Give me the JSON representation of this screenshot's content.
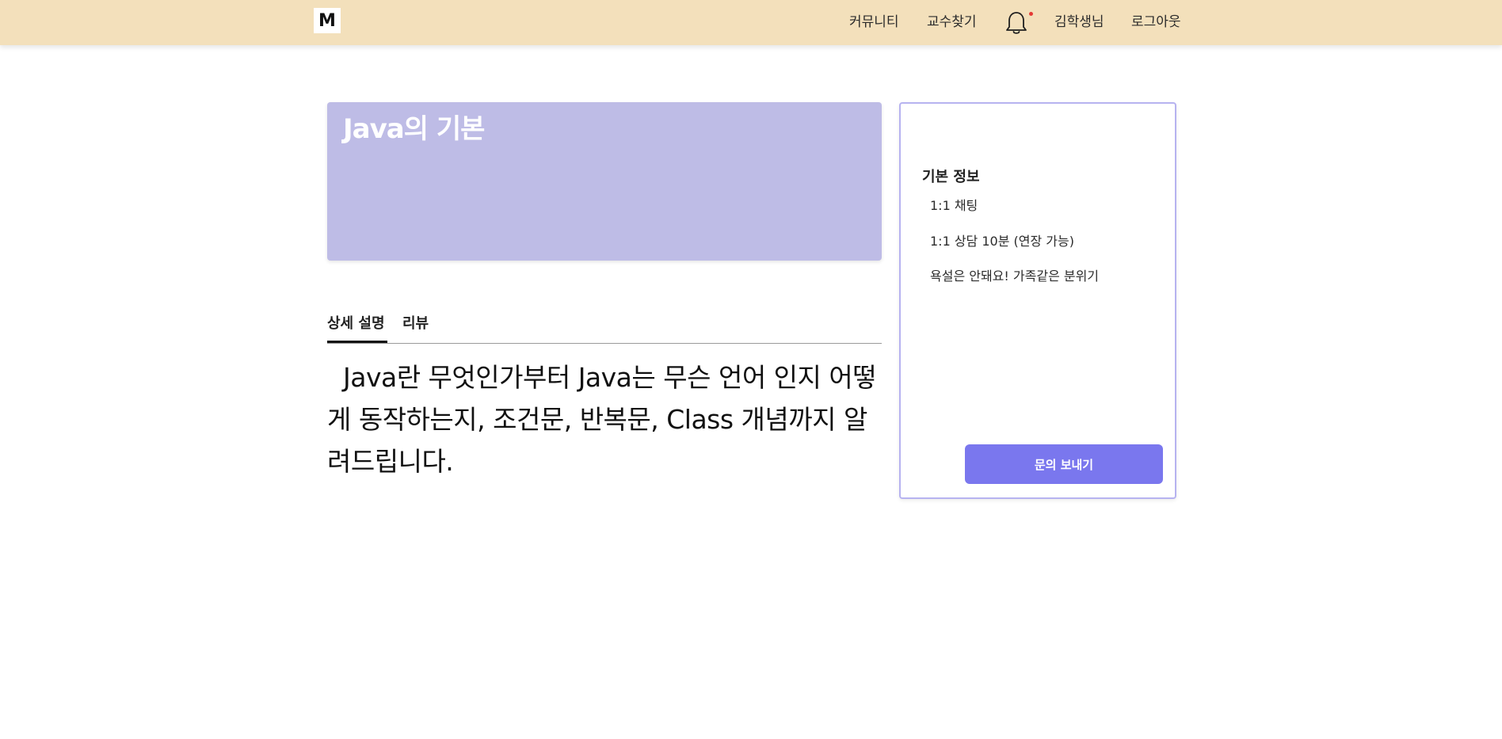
{
  "colors": {
    "header_bg": "#f3e0bb",
    "banner_bg": "#bebce6",
    "accent": "#7a77ee",
    "notification_dot": "#e53935"
  },
  "header": {
    "logo_text": "M",
    "nav": {
      "community": "커뮤니티",
      "find_professor": "교수찾기",
      "bell_icon": "bell-icon",
      "user": "김학생님",
      "logout": "로그아웃"
    }
  },
  "course": {
    "title": "Java의 기본",
    "tabs": [
      "상세 설명",
      "리뷰"
    ],
    "active_tab": "상세 설명",
    "description": "  Java란 무엇인가부터 Java는 무슨 언어 인지 어떻게 동작하는지, 조건문, 반복문, Class 개념까지 알려드립니다."
  },
  "sidebar": {
    "title": "기본 정보",
    "items": [
      "1:1 채팅",
      "1:1 상담 10분 (연장 가능)",
      "욕설은 안돼요! 가족같은 분위기"
    ],
    "button_label": "문의 보내기"
  }
}
